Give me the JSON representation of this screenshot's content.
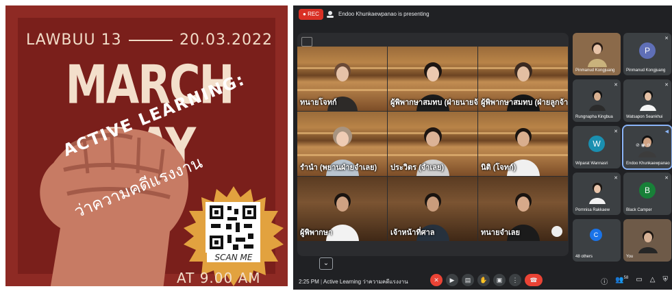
{
  "poster": {
    "org": "LAWBUU 13",
    "date": "20.03.2022",
    "title": "MARCH DAY",
    "slogan_line1": "ACTIVE LEARNING:",
    "slogan_line2": "ว่าความคดีแรงงาน",
    "qr_caption": "SCAN ME",
    "time": "AT 9.00 AM",
    "colors": {
      "background": "#8e2a24",
      "fist": "#c77b64",
      "badge": "#e2a23f",
      "text": "#f3dfcb"
    }
  },
  "meet": {
    "rec_label": "REC",
    "presenting_text": "Endoo Khunkaewpanao is presenting",
    "stage_tiles": [
      {
        "label": "ทนายโจทก์"
      },
      {
        "label": "ผู้พิพากษาสมทบ (ฝ่ายนายจ้าง)"
      },
      {
        "label": "ผู้พิพากษาสมทบ (ฝ่ายลูกจ้าง)"
      },
      {
        "label": "รำนำ (พยานฝ่ายจำเลย)"
      },
      {
        "label": "ประวิตร (จำเลย)"
      },
      {
        "label": "นิติ (โจทก์)"
      },
      {
        "label": "ผู้พิพากษา"
      },
      {
        "label": "เจ้าหน้าที่ศาล"
      },
      {
        "label": "ทนายจำเลย"
      }
    ],
    "participants": [
      {
        "name": "Pinmanud Kongjuang",
        "avatar": "",
        "type": "video"
      },
      {
        "name": "Pinmanud Kongjuang",
        "avatar": "P",
        "type": "letter",
        "color": "#5f6fb7"
      },
      {
        "name": "Rungnapha Kingbua",
        "avatar": "",
        "type": "video"
      },
      {
        "name": "Watsapon Seankhui",
        "avatar": "",
        "type": "video"
      },
      {
        "name": "Wiparat Wannasri",
        "avatar": "W",
        "type": "letter",
        "color": "#1a8fb0"
      },
      {
        "name": "Endoo Khunkaewpanao",
        "avatar": "",
        "type": "video",
        "active": true
      },
      {
        "name": "Pornnisa Rakkaew",
        "avatar": "",
        "type": "video"
      },
      {
        "name": "Black Camper",
        "avatar": "B",
        "type": "letter",
        "color": "#188038"
      },
      {
        "name": "48 others",
        "avatar": "C",
        "type": "letter",
        "color": "#1a73e8"
      },
      {
        "name": "You",
        "avatar": "",
        "type": "video"
      }
    ],
    "time": "2:25 PM",
    "meeting_name": "Active Learning ว่าความคดีแรงงาน",
    "controls": [
      "mic-off-icon",
      "camera-icon",
      "captions-icon",
      "raise-hand-icon",
      "present-icon",
      "more-icon",
      "end-call-icon"
    ],
    "participants_count": "58"
  }
}
